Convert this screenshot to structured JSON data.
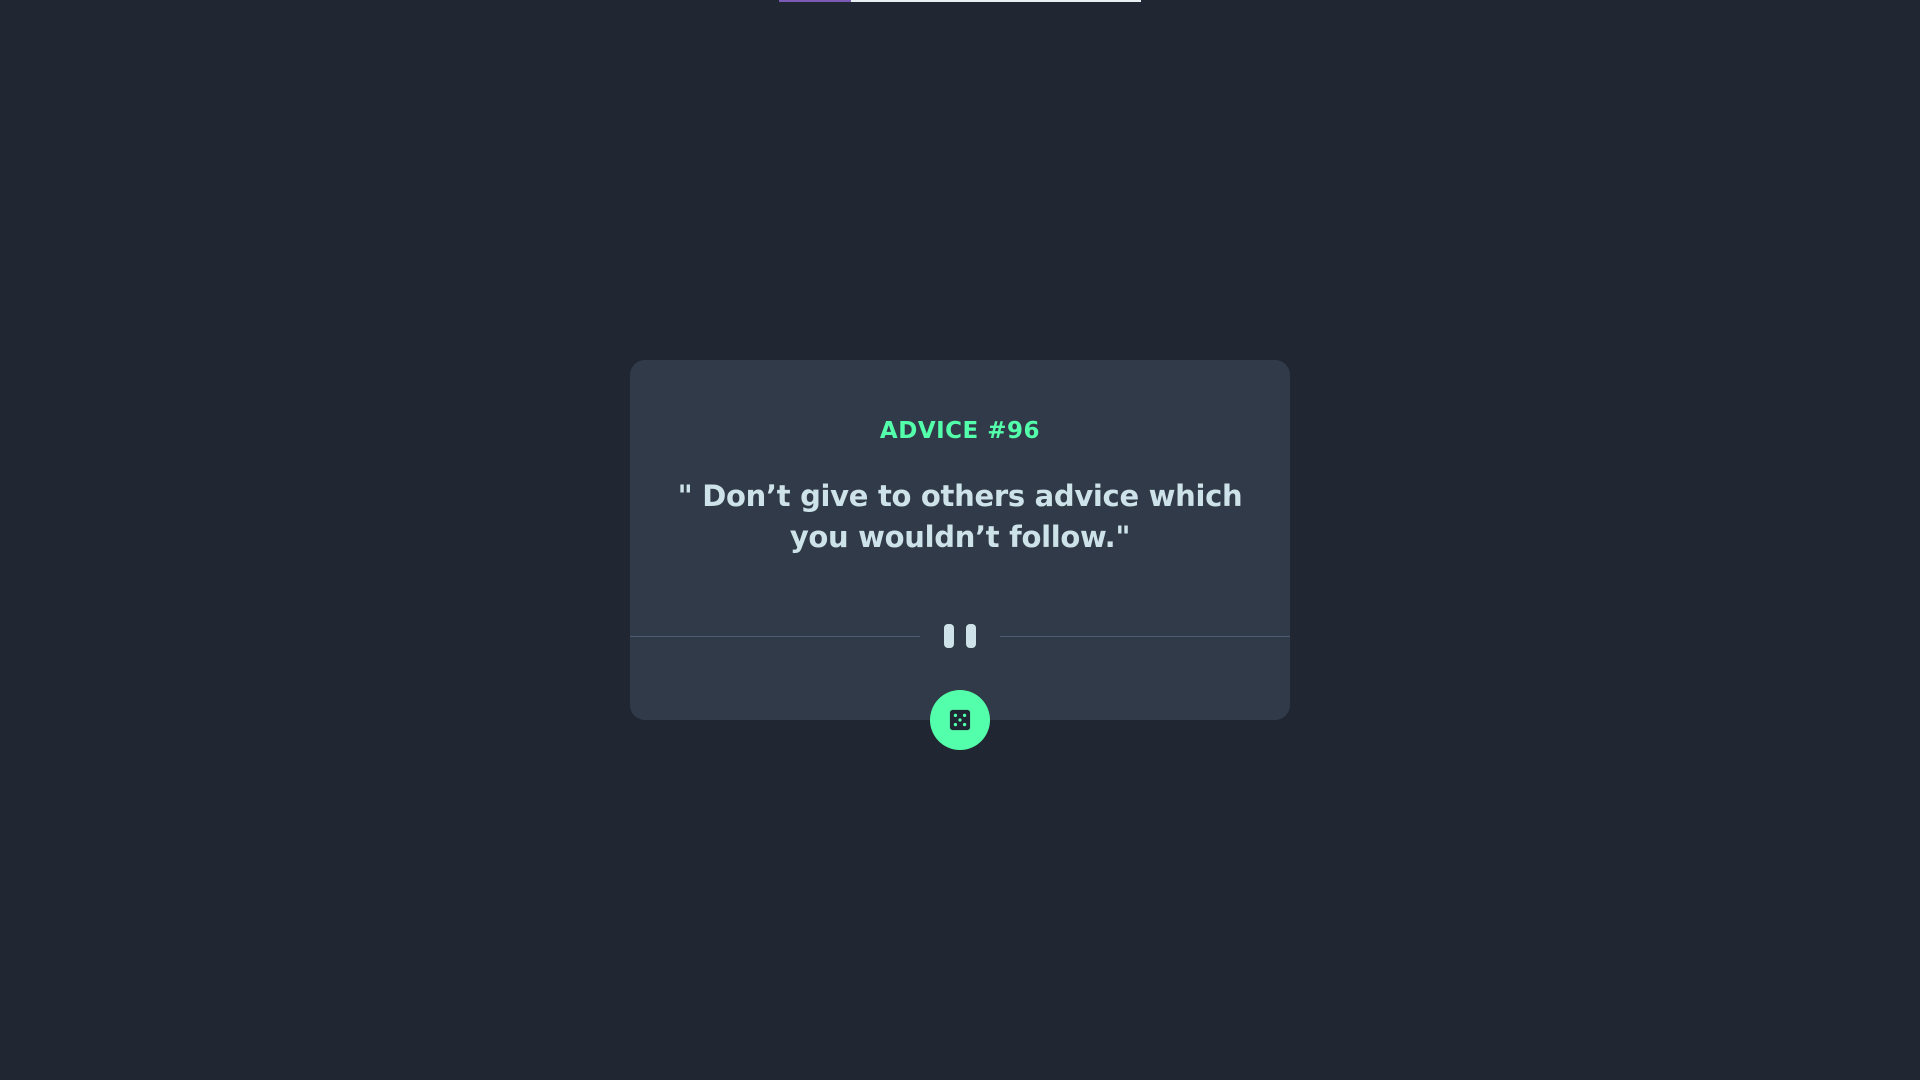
{
  "progress": {
    "fraction": 0.2
  },
  "advice": {
    "number_label": "ADVICE #96",
    "quote": "\" Don’t give to others advice which you wouldn’t follow.\""
  },
  "icons": {
    "divider": "pause-icon",
    "button": "dice-icon"
  },
  "colors": {
    "background": "#202632",
    "card": "#313a48",
    "accent": "#53ffaa",
    "text": "#cee3e9",
    "divider": "#4f5d74",
    "progress_fill": "#7b5bb5",
    "progress_track": "#e9eef2"
  }
}
